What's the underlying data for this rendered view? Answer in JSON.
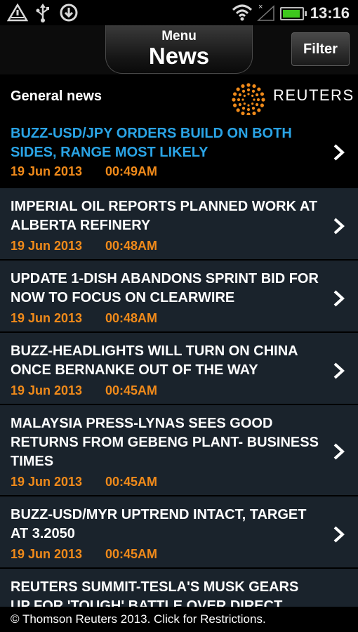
{
  "status": {
    "time": "13:16",
    "icons": [
      "warning-triangle-icon",
      "usb-icon",
      "download-icon",
      "wifi-icon",
      "signal-icon",
      "battery-icon"
    ],
    "battery_color": "#3ec81e"
  },
  "header": {
    "menu_label": "Menu",
    "title": "News",
    "filter_label": "Filter"
  },
  "section": {
    "title": "General news",
    "brand": "REUTERS",
    "brand_color": "#f08a1a"
  },
  "articles": [
    {
      "headline": "BUZZ-USD/JPY ORDERS BUILD ON BOTH SIDES, RANGE MOST LIKELY",
      "date": "19 Jun 2013",
      "time": "00:49AM",
      "highlighted": true
    },
    {
      "headline": "IMPERIAL OIL REPORTS PLANNED WORK AT ALBERTA REFINERY",
      "date": "19 Jun 2013",
      "time": "00:48AM"
    },
    {
      "headline": "UPDATE 1-DISH ABANDONS SPRINT BID FOR NOW TO FOCUS ON CLEARWIRE",
      "date": "19 Jun 2013",
      "time": "00:48AM"
    },
    {
      "headline": "BUZZ-HEADLIGHTS WILL TURN ON CHINA ONCE BERNANKE OUT OF THE WAY",
      "date": "19 Jun 2013",
      "time": "00:45AM"
    },
    {
      "headline": "MALAYSIA PRESS-LYNAS SEES GOOD RETURNS FROM GEBENG PLANT- BUSINESS TIMES",
      "date": "19 Jun 2013",
      "time": "00:45AM"
    },
    {
      "headline": "BUZZ-USD/MYR UPTREND INTACT, TARGET AT 3.2050",
      "date": "19 Jun 2013",
      "time": "00:45AM"
    },
    {
      "headline": "REUTERS SUMMIT-TESLA'S MUSK GEARS UP FOR 'TOUGH' BATTLE OVER DIRECT",
      "date": "",
      "time": ""
    }
  ],
  "colors": {
    "headline_highlight": "#2aa4e6",
    "timestamp": "#f08a1a",
    "row_background": "#1a232c"
  },
  "footer": {
    "text": "© Thomson Reuters 2013. Click for Restrictions."
  }
}
